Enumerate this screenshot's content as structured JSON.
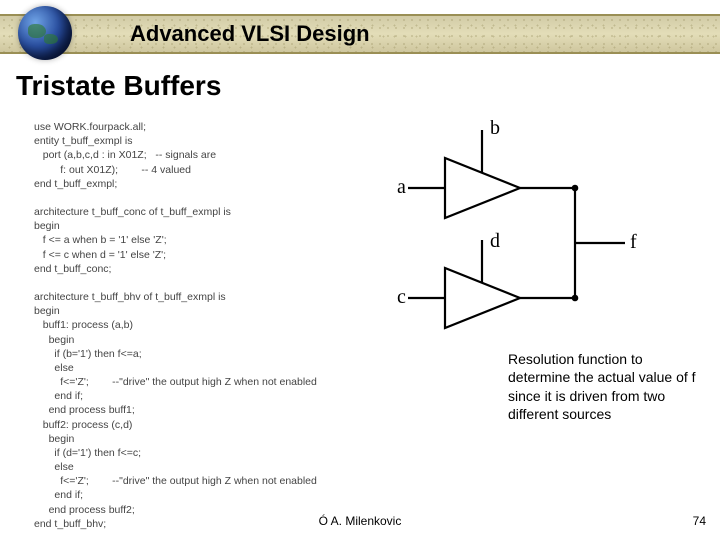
{
  "header": {
    "course_title": "Advanced VLSI Design"
  },
  "title": "Tristate Buffers",
  "vhdl_code": "use WORK.fourpack.all;\nentity t_buff_exmpl is\n   port (a,b,c,d : in X01Z;   -- signals are\n         f: out X01Z);        -- 4 valued\nend t_buff_exmpl;\n\narchitecture t_buff_conc of t_buff_exmpl is\nbegin\n   f <= a when b = '1' else 'Z';\n   f <= c when d = '1' else 'Z';\nend t_buff_conc;\n\narchitecture t_buff_bhv of t_buff_exmpl is\nbegin\n   buff1: process (a,b)\n     begin\n       if (b='1') then f<=a;\n       else\n         f<='Z';        --\"drive\" the output high Z when not enabled\n       end if;\n     end process buff1;\n   buff2: process (c,d)\n     begin\n       if (d='1') then f<=c;\n       else\n         f<='Z';        --\"drive\" the output high Z when not enabled\n       end if;\n     end process buff2;\nend t_buff_bhv;",
  "diagram": {
    "inputs": {
      "a": "a",
      "b": "b",
      "c": "c",
      "d": "d"
    },
    "output": "f"
  },
  "annotation": "Resolution function to determine the actual value of f since it is driven from two different sources",
  "footer": {
    "author": "Ó  A. Milenkovic",
    "page": "74"
  }
}
